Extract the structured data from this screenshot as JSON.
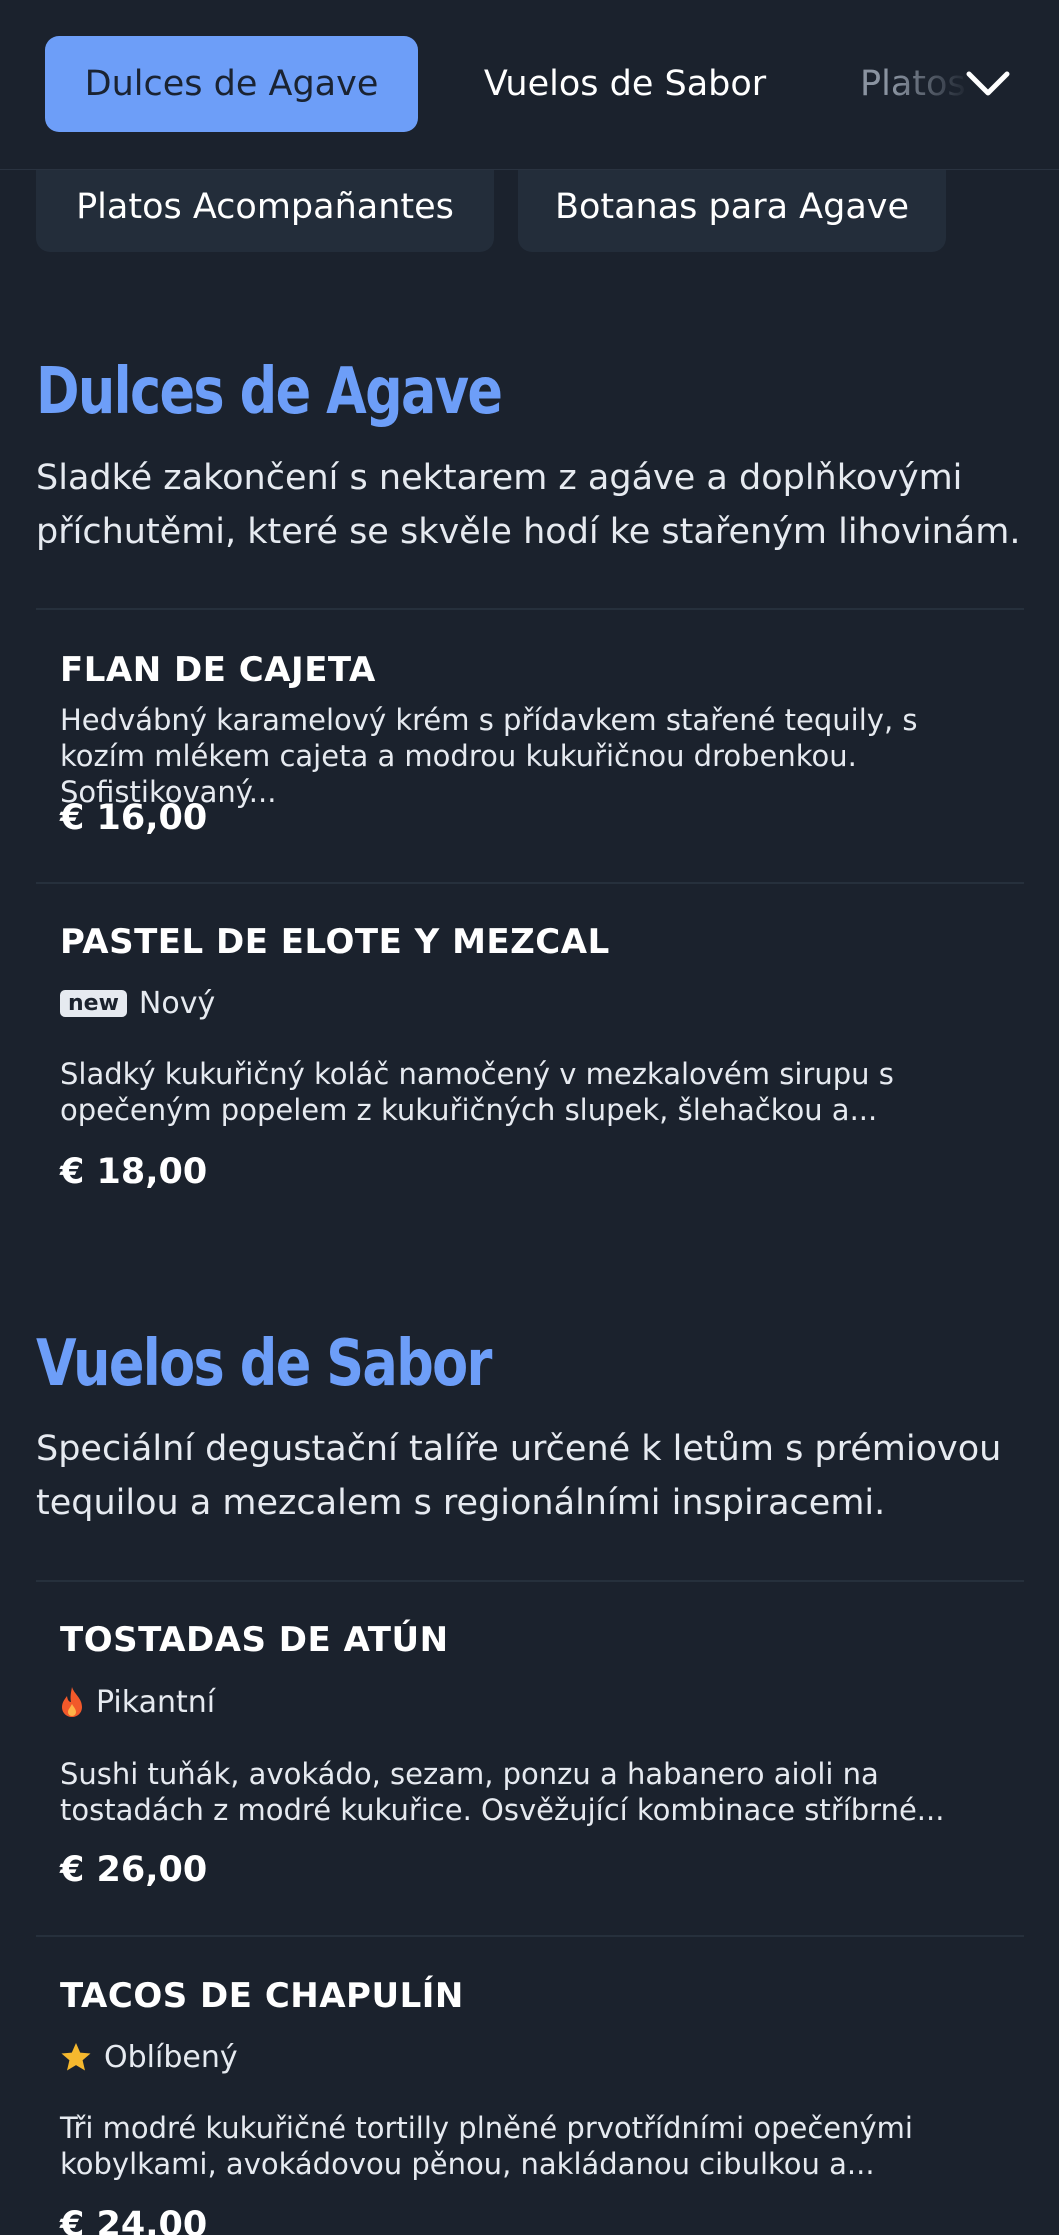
{
  "tabs": [
    {
      "label": "Dulces de Agave",
      "active": true
    },
    {
      "label": "Vuelos de Sabor",
      "active": false
    },
    {
      "label": "Platos Acompañantes",
      "active": false
    }
  ],
  "chips": [
    {
      "label": "Platos Acompañantes"
    },
    {
      "label": "Botanas para Agave"
    }
  ],
  "sections": [
    {
      "title": "Dulces de Agave",
      "description": "Sladké zakončení s nektarem z agáve a doplňkovými příchutěmi, které se skvěle hodí ke stařeným lihovinám.",
      "items": [
        {
          "name": "FLAN DE CAJETA",
          "description": "Hedvábný karamelový krém s přídavkem stařené tequily, s kozím mlékem cajeta a modrou kukuřičnou drobenkou. Sofistikovaný...",
          "price": "€ 16,00"
        },
        {
          "name": "PASTEL DE ELOTE Y MEZCAL",
          "tag_badge": "new",
          "tag": "Nový",
          "description": "Sladký kukuřičný koláč namočený v mezkalovém sirupu s opečeným popelem z kukuřičných slupek, šlehačkou a...",
          "price": "€ 18,00"
        }
      ]
    },
    {
      "title": "Vuelos de Sabor",
      "description": "Speciální degustační talíře určené k letům s prémiovou tequilou a mezcalem s regionálními inspiracemi.",
      "items": [
        {
          "name": "TOSTADAS DE ATÚN",
          "tag": "Pikantní",
          "tag_icon": "flame-icon",
          "description": "Sushi tuňák, avokádo, sezam, ponzu a habanero aioli na tostadách z modré kukuřice. Osvěžující kombinace stříbrné...",
          "price": "€ 26,00"
        },
        {
          "name": "TACOS DE CHAPULÍN",
          "tag": "Oblíbený",
          "tag_icon": "star-icon",
          "description": "Tři modré kukuřičné tortilly plněné prvotřídními opečenými kobylkami, avokádovou pěnou, nakládanou cibulkou a...",
          "price": "€ 24,00"
        }
      ]
    }
  ],
  "colors": {
    "background": "#1b222d",
    "accent": "#6d9ef8",
    "chip": "#232d3a",
    "flame": "#f2592a",
    "star": "#f5b82e"
  }
}
